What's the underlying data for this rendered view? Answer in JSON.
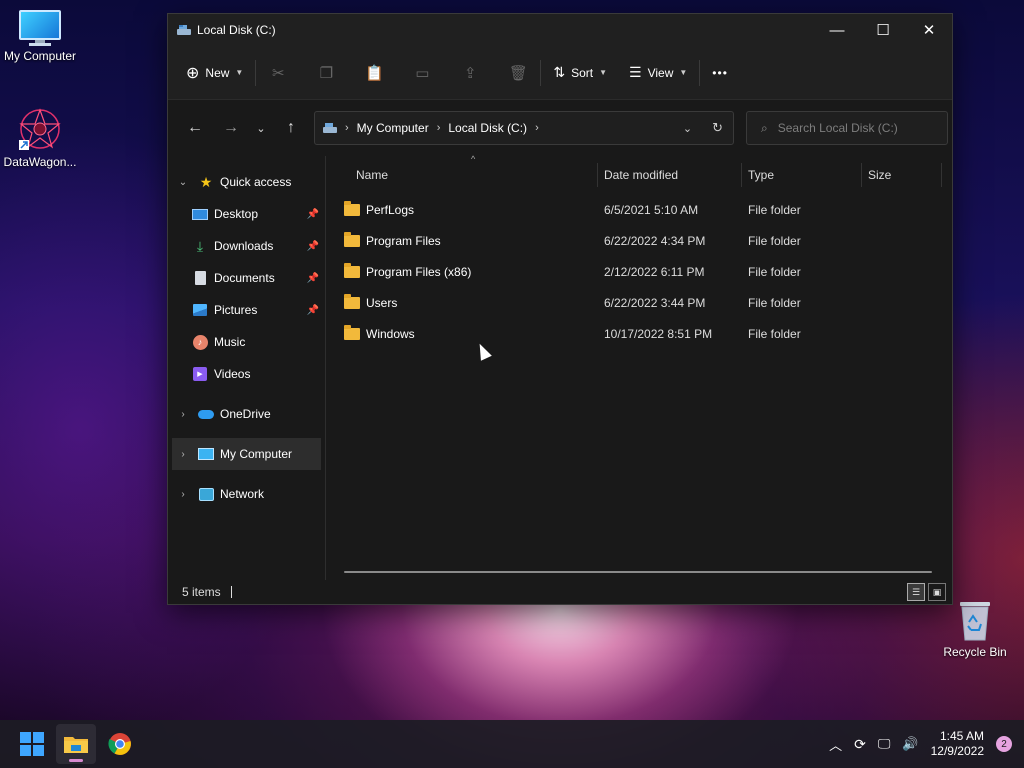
{
  "desktop": {
    "icons": [
      {
        "label": "My Computer"
      },
      {
        "label": "DataWagon..."
      },
      {
        "label": "Recycle Bin"
      }
    ]
  },
  "window": {
    "title": "Local Disk (C:)",
    "controls": {
      "minimize": "—",
      "maximize": "☐",
      "close": "✕"
    }
  },
  "commandbar": {
    "new_label": "New",
    "sort_label": "Sort",
    "view_label": "View",
    "more_label": "•••"
  },
  "address": {
    "crumbs": [
      "My Computer",
      "Local Disk (C:)"
    ],
    "search_placeholder": "Search Local Disk (C:)"
  },
  "navpane": {
    "quick_access": "Quick access",
    "desktop": "Desktop",
    "downloads": "Downloads",
    "documents": "Documents",
    "pictures": "Pictures",
    "music": "Music",
    "videos": "Videos",
    "onedrive": "OneDrive",
    "my_computer": "My Computer",
    "network": "Network"
  },
  "columns": {
    "name": "Name",
    "date": "Date modified",
    "type": "Type",
    "size": "Size"
  },
  "files": [
    {
      "name": "PerfLogs",
      "date": "6/5/2021 5:10 AM",
      "type": "File folder"
    },
    {
      "name": "Program Files",
      "date": "6/22/2022 4:34 PM",
      "type": "File folder"
    },
    {
      "name": "Program Files (x86)",
      "date": "2/12/2022 6:11 PM",
      "type": "File folder"
    },
    {
      "name": "Users",
      "date": "6/22/2022 3:44 PM",
      "type": "File folder"
    },
    {
      "name": "Windows",
      "date": "10/17/2022 8:51 PM",
      "type": "File folder"
    }
  ],
  "status": {
    "items": "5 items"
  },
  "taskbar": {
    "time": "1:45 AM",
    "date": "12/9/2022",
    "notifications": "2"
  },
  "colors": {
    "accent": "#3ea6ff",
    "folder": "#f2b93b",
    "badge": "#e6a3e0"
  }
}
